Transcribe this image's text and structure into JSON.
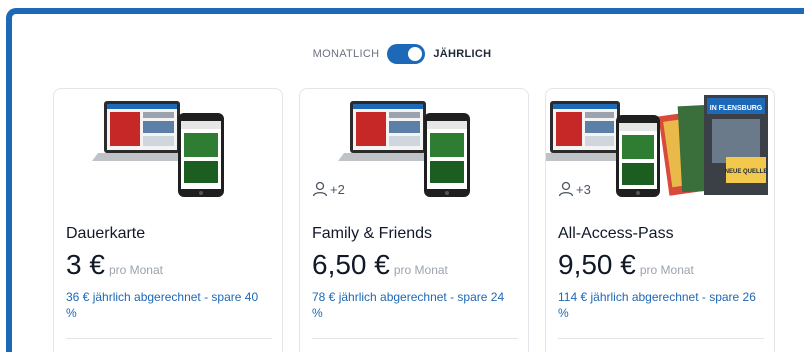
{
  "toggle": {
    "monthly_label": "MONATLICH",
    "yearly_label": "JÄHRLICH",
    "selected": "yearly"
  },
  "brand_color": "#1d68b7",
  "plans": [
    {
      "name": "Dauerkarte",
      "price": "3 €",
      "period": "pro Monat",
      "billing": "36 € jährlich abgerechnet - spare 40 %",
      "extra_users": "",
      "image": "laptop-and-phone"
    },
    {
      "name": "Family & Friends",
      "price": "6,50 €",
      "period": "pro Monat",
      "billing": "78 € jährlich abgerechnet - spare 24 %",
      "extra_users": "+2",
      "image": "laptop-and-phone"
    },
    {
      "name": "All-Access-Pass",
      "price": "9,50 €",
      "period": "pro Monat",
      "billing": "114 € jährlich abgerechnet - spare 26 %",
      "extra_users": "+3",
      "image": "laptop-phone-and-magazines",
      "magazine_cover_text": "IN FLENSBURG",
      "magazine_badge_text": "NEUE QUELLE"
    }
  ]
}
